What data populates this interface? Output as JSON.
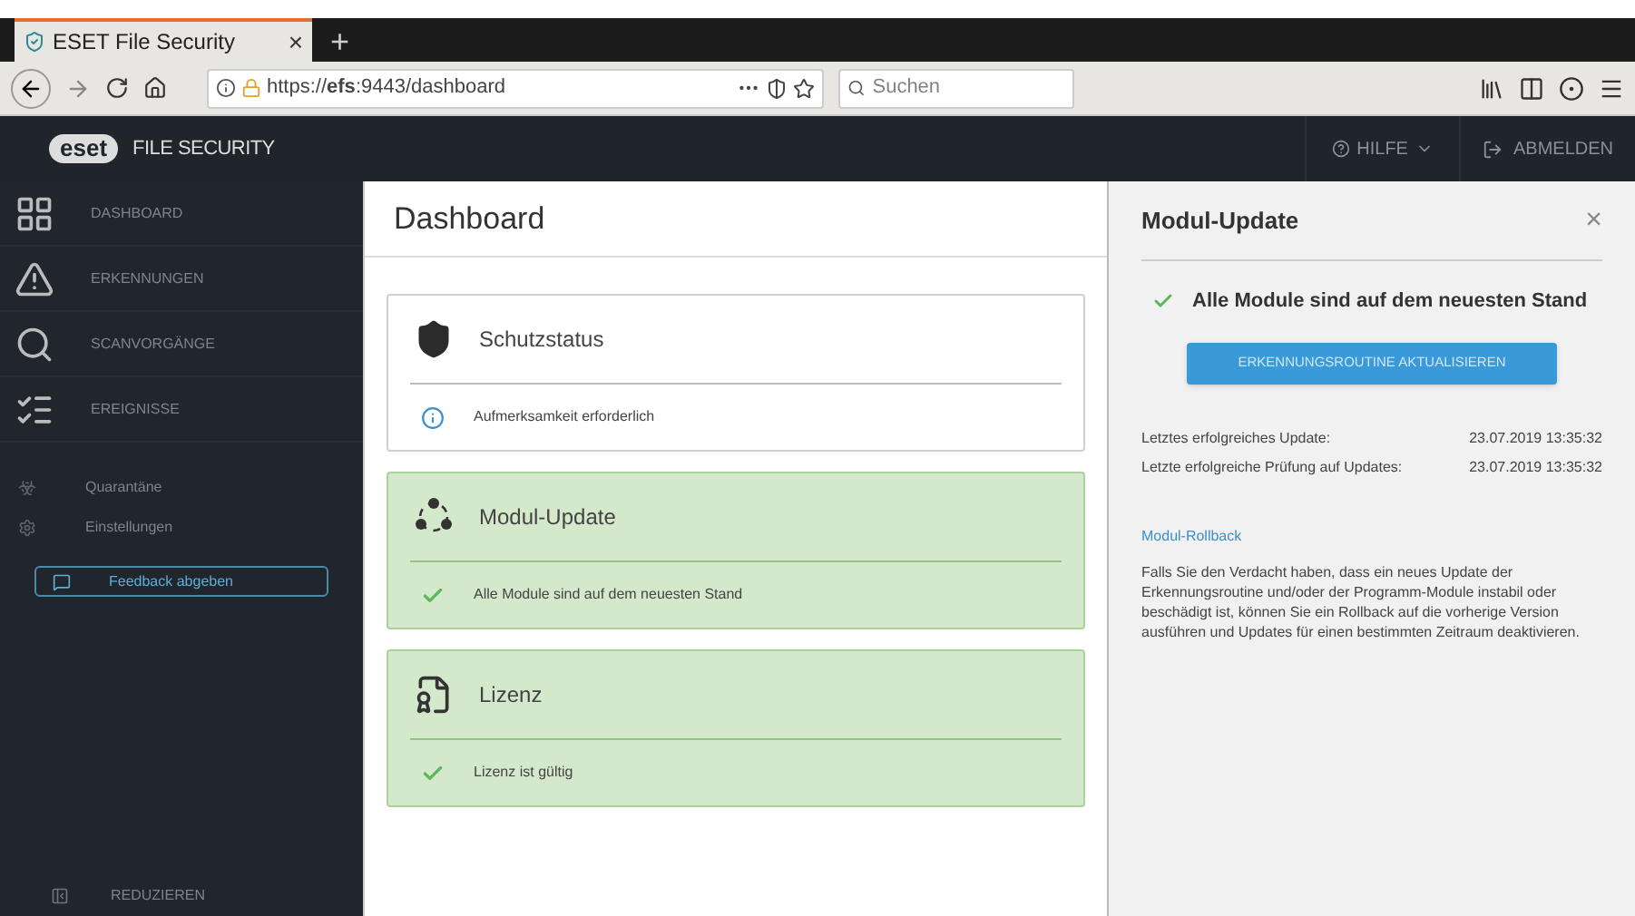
{
  "browser": {
    "tab": {
      "title": "ESET File Security",
      "close": "×",
      "new_tab": "+"
    },
    "url": "https://**efs**:9443/dashboard",
    "search": {
      "placeholder": "Suchen"
    }
  },
  "app_header": {
    "logo": "eset",
    "product": "FILE SECURITY",
    "help": "HILFE",
    "logout": "ABMELDEN"
  },
  "sidebar": {
    "main_items": [
      {
        "label": "DASHBOARD",
        "kind": "dashboard"
      },
      {
        "label": "ERKENNUNGEN",
        "kind": "detections"
      },
      {
        "label": "SCANVORGÄNGE",
        "kind": "scans"
      },
      {
        "label": "EREIGNISSE",
        "kind": "events"
      }
    ],
    "sub_items": [
      {
        "label": "Quarantäne",
        "kind": "quarantine"
      },
      {
        "label": "Einstellungen",
        "kind": "settings"
      }
    ],
    "feedback": "Feedback abgeben",
    "collapse": "REDUZIEREN"
  },
  "main": {
    "title": "Dashboard",
    "cards": [
      {
        "title": "Schutzstatus",
        "kind": "shield",
        "healthy": false,
        "message": "Aufmerksamkeit erforderlich"
      },
      {
        "title": "Modul-Update",
        "kind": "modules",
        "healthy": true,
        "message": "Alle Module sind auf dem neuesten Stand"
      },
      {
        "title": "Lizenz",
        "kind": "license",
        "healthy": true,
        "message": "Lizenz ist gültig"
      }
    ]
  },
  "panel": {
    "title": "Modul-Update",
    "close": "×",
    "status": "Alle Module sind auf dem neuesten Stand",
    "button": "ERKENNUNGSROUTINE AKTUALISIEREN",
    "rows": [
      {
        "label": "Letztes erfolgreiches Update:",
        "value": "23.07.2019 13:35:32"
      },
      {
        "label": "Letzte erfolgreiche Prüfung auf Updates:",
        "value": "23.07.2019 13:35:32"
      }
    ],
    "link": "Modul-Rollback",
    "text": "Falls Sie den Verdacht haben, dass ein neues Update der Erkennungsroutine und/oder der Programm-Module instabil oder beschädigt ist, können Sie ein Rollback auf die vorherige Version ausführen und Updates für einen bestimmten Zeitraum deaktivieren."
  }
}
